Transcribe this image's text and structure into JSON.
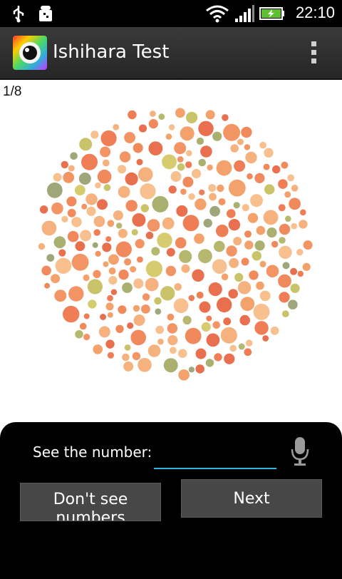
{
  "status_bar": {
    "time": "22:10",
    "icons": [
      "usb-icon",
      "android-debug-icon",
      "wifi-icon",
      "signal-icon",
      "battery-charging-icon"
    ]
  },
  "action_bar": {
    "title": "Ishihara Test",
    "app_icon": "color-wheel-eye-icon",
    "overflow_icon": "overflow-menu-icon"
  },
  "test": {
    "progress": "1/8",
    "plate": "ishihara-color-plate"
  },
  "answer_panel": {
    "prompt": "See the number:",
    "input_value": "",
    "mic_icon": "microphone-icon",
    "dont_see_label": "Don't see numbers",
    "next_label": "Next"
  },
  "colors": {
    "accent": "#33b5e5",
    "panel": "#000000",
    "button": "#474747"
  }
}
